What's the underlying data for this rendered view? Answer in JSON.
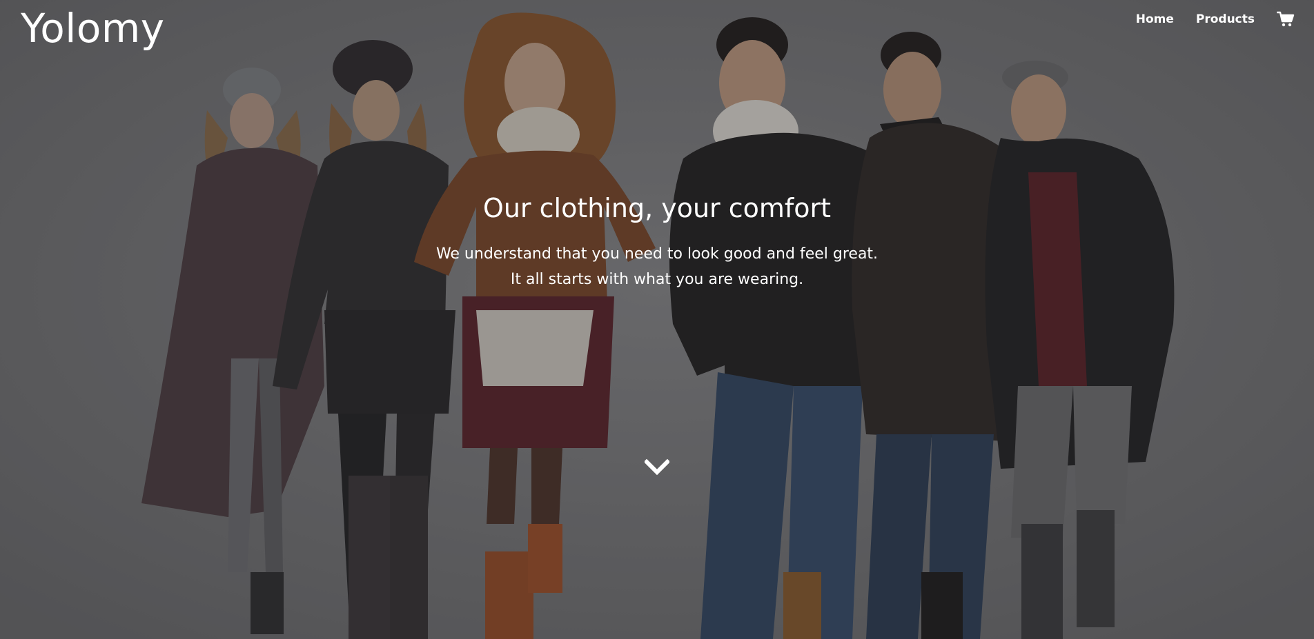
{
  "brand": {
    "name": "Yolomy"
  },
  "nav": {
    "items": [
      {
        "label": "Home"
      },
      {
        "label": "Products"
      }
    ],
    "cart_icon": "shopping-cart-icon"
  },
  "hero": {
    "headline": "Our clothing, your comfort",
    "subtitle_line1": "We understand that you need to look good and feel great.",
    "subtitle_line2": "It all starts with what you are wearing.",
    "scroll_icon": "chevron-down-icon",
    "image_description_icon": "hero-photo"
  },
  "colors": {
    "overlay": "#6d6d6e",
    "text": "#ffffff"
  }
}
